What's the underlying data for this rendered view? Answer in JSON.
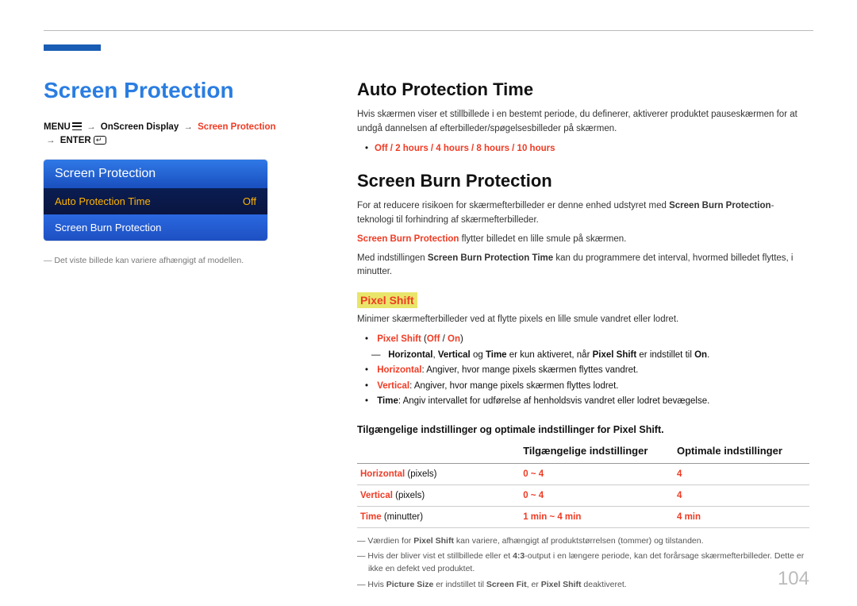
{
  "page_number": "104",
  "left": {
    "title": "Screen Protection",
    "breadcrumb": {
      "menu": "MENU",
      "path1": "OnScreen Display",
      "path2": "Screen Protection",
      "enter": "ENTER"
    },
    "osd": {
      "header": "Screen Protection",
      "row_selected_label": "Auto Protection Time",
      "row_selected_value": "Off",
      "row_item_label": "Screen Burn Protection"
    },
    "footnote": "Det viste billede kan variere afhængigt af modellen."
  },
  "auto_protection": {
    "title": "Auto Protection Time",
    "desc": "Hvis skærmen viser et stillbillede i en bestemt periode, du definerer, aktiverer produktet pauseskærmen for at undgå dannelsen af efterbilleder/spøgelsesbilleder på skærmen.",
    "options": "Off / 2 hours / 4 hours / 8 hours / 10 hours"
  },
  "burn": {
    "title": "Screen Burn Protection",
    "p1_pre": "For at reducere risikoen for skærmefterbilleder er denne enhed udstyret med ",
    "p1_bold": "Screen Burn Protection",
    "p1_post": "-teknologi til forhindring af skærmefterbilleder.",
    "p2_bold": "Screen Burn Protection",
    "p2_post": " flytter billedet en lille smule på skærmen.",
    "p3_pre": "Med indstillingen ",
    "p3_bold": "Screen Burn Protection Time",
    "p3_post": " kan du programmere det interval, hvormed billedet flyttes, i minutter."
  },
  "pixel_shift": {
    "heading": "Pixel Shift",
    "desc": "Minimer skærmefterbilleder ved at flytte pixels en lille smule vandret eller lodret.",
    "opt1_label": "Pixel Shift",
    "opt1_vals": " (Off / On)",
    "nested_pre": "Horizontal",
    "nested_mid1": ", ",
    "nested_v": "Vertical",
    "nested_mid2": " og ",
    "nested_t": "Time",
    "nested_txt": " er kun aktiveret, når ",
    "nested_ps": "Pixel Shift",
    "nested_txt2": " er indstillet til ",
    "nested_on": "On",
    "nested_end": ".",
    "opt_h_label": "Horizontal",
    "opt_h_txt": ": Angiver, hvor mange pixels skærmen flyttes vandret.",
    "opt_v_label": "Vertical",
    "opt_v_txt": ": Angiver, hvor mange pixels skærmen flyttes lodret.",
    "opt_t_label": "Time",
    "opt_t_txt": ": Angiv intervallet for udførelse af henholdsvis vandret eller lodret bevægelse.",
    "table_caption": "Tilgængelige indstillinger og optimale indstillinger for Pixel Shift.",
    "th1": "",
    "th2": "Tilgængelige indstillinger",
    "th3": "Optimale indstillinger",
    "r1_label": "Horizontal",
    "r1_unit": " (pixels)",
    "r1_avail": "0 ~ 4",
    "r1_opt": "4",
    "r2_label": "Vertical",
    "r2_unit": " (pixels)",
    "r2_avail": "0 ~ 4",
    "r2_opt": "4",
    "r3_label": "Time",
    "r3_unit": " (minutter)",
    "r3_avail": "1 min ~ 4 min",
    "r3_opt": "4 min",
    "note1_pre": "Værdien for ",
    "note1_b": "Pixel Shift",
    "note1_post": " kan variere, afhængigt af produktstørrelsen (tommer) og tilstanden.",
    "note2_pre": "Hvis der bliver vist et stillbillede eller et ",
    "note2_b": "4:3",
    "note2_post": "-output i en længere periode, kan det forårsage skærmefterbilleder. Dette er ikke en defekt ved produktet.",
    "note3_pre": "Hvis ",
    "note3_b1": "Picture Size",
    "note3_mid1": " er indstillet til ",
    "note3_b2": "Screen Fit",
    "note3_mid2": ", er ",
    "note3_b3": "Pixel Shift",
    "note3_post": " deaktiveret."
  },
  "chart_data": {
    "type": "table",
    "title": "Tilgængelige indstillinger og optimale indstillinger for Pixel Shift.",
    "columns": [
      "",
      "Tilgængelige indstillinger",
      "Optimale indstillinger"
    ],
    "rows": [
      {
        "label": "Horizontal (pixels)",
        "available": "0 ~ 4",
        "optimal": "4"
      },
      {
        "label": "Vertical (pixels)",
        "available": "0 ~ 4",
        "optimal": "4"
      },
      {
        "label": "Time (minutter)",
        "available": "1 min ~ 4 min",
        "optimal": "4 min"
      }
    ]
  }
}
